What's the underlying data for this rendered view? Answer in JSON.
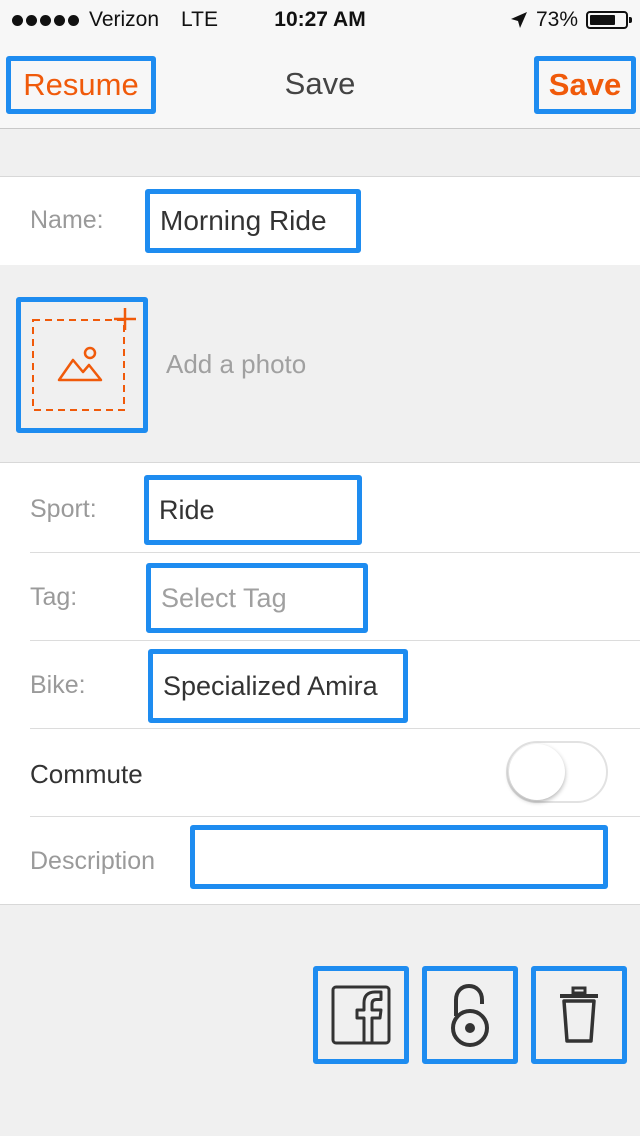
{
  "status_bar": {
    "carrier": "Verizon",
    "network": "LTE",
    "time": "10:27 AM",
    "battery": "73%",
    "battery_level": 0.73,
    "location_icon": "location-arrow-icon"
  },
  "nav": {
    "resume_label": "Resume",
    "title": "Save",
    "save_label": "Save"
  },
  "form": {
    "name_label": "Name:",
    "name_value": "Morning Ride",
    "photo_label": "Add a photo",
    "photo_icon": "add-photo-icon",
    "sport_label": "Sport:",
    "sport_value": "Ride",
    "tag_label": "Tag:",
    "tag_placeholder": "Select Tag",
    "bike_label": "Bike:",
    "bike_value": "Specialized Amira",
    "commute_label": "Commute",
    "commute_on": false,
    "description_label": "Description",
    "description_value": ""
  },
  "actions": {
    "facebook_icon": "facebook-icon",
    "privacy_icon": "unlock-icon",
    "delete_icon": "trash-icon"
  },
  "colors": {
    "accent": "#F05A0A",
    "highlight": "#1E8CF0",
    "background": "#F0F0F0"
  }
}
